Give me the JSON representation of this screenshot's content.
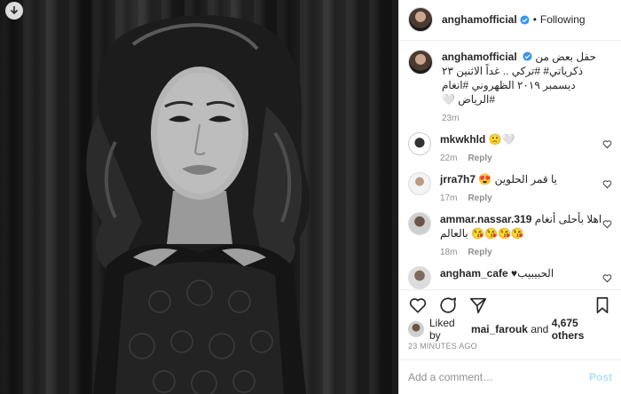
{
  "header": {
    "username": "anghamofficial",
    "follow_state": "Following",
    "separator": "•"
  },
  "caption": {
    "username": "anghamofficial",
    "text": "حفل بعض من ذكرياتي# #تركي .. غداً الاثنين ٢٣ ديسمبر ٢٠١٩ الظهروني #انغام #الرياض 🤍",
    "time": "23m"
  },
  "comments": [
    {
      "username": "mkwkhld",
      "text": "🙁🤍",
      "time": "22m",
      "reply": "Reply"
    },
    {
      "username": "jrra7h7",
      "text": "يا قمر الحلوين 😍",
      "time": "17m",
      "reply": "Reply"
    },
    {
      "username": "ammar.nassar.319",
      "text": "اهلا بأحلى أنغام 😘😘😘😘 بالعالم",
      "time": "18m",
      "reply": "Reply"
    },
    {
      "username": "angham_cafe",
      "text": "الحبيبيب♥",
      "time": "",
      "reply": ""
    }
  ],
  "likes": {
    "prefix": "Liked by",
    "user": "mai_farouk",
    "conj": "and",
    "count": "4,675 others"
  },
  "time_ago": "23 MINUTES AGO",
  "add_comment": {
    "placeholder": "Add a comment…",
    "post_label": "Post"
  },
  "colors": {
    "verified": "#3897f0",
    "muted": "#8e8e8e",
    "post_button": "#b2dffc"
  },
  "icons": [
    "download-icon",
    "verified-badge-icon",
    "heart-icon",
    "comment-icon",
    "share-icon",
    "bookmark-icon"
  ]
}
